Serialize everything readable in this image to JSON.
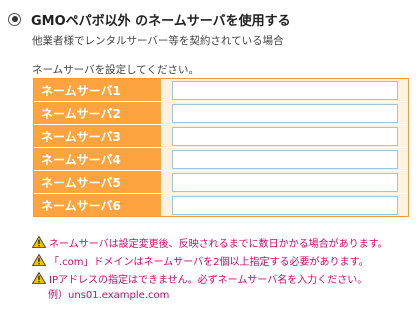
{
  "option": {
    "title": "GMOペパボ以外 のネームサーバを使用する",
    "subtitle": "他業者様でレンタルサーバー等を契約されている場合",
    "selected": true
  },
  "instruction": "ネームサーバを設定してください。",
  "nameservers": [
    {
      "label": "ネームサーバ1",
      "value": ""
    },
    {
      "label": "ネームサーバ2",
      "value": ""
    },
    {
      "label": "ネームサーバ3",
      "value": ""
    },
    {
      "label": "ネームサーバ4",
      "value": ""
    },
    {
      "label": "ネームサーバ5",
      "value": ""
    },
    {
      "label": "ネームサーバ6",
      "value": ""
    }
  ],
  "notes": [
    "ネームサーバは設定変更後、反映されるまでに数日かかる場合があります。",
    "「.com」ドメインはネームサーバを2個以上指定する必要があります。",
    "IPアドレスの指定はできません。必ずネームサーバ名を入力ください。"
  ],
  "example": "例）uns01.example.com",
  "colors": {
    "label_bg": "#fda440",
    "input_cell_bg": "#fdf1e2",
    "input_border": "#9ec6d6",
    "note_text": "#d0086b",
    "warning_icon": "#f2c200"
  },
  "icons": {
    "radio": "radio-selected",
    "note": "warning-triangle-icon"
  }
}
